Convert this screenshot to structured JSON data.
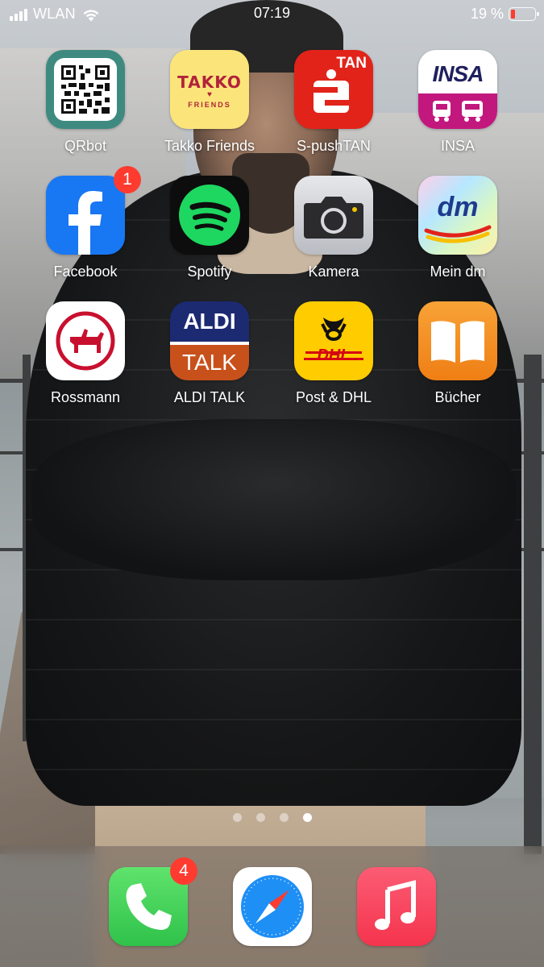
{
  "status_bar": {
    "carrier": "WLAN",
    "time": "07:19",
    "battery_text": "19 %",
    "battery_level": 0.19
  },
  "apps": [
    {
      "label": "QRbot",
      "icon": "qr-code-icon"
    },
    {
      "label": "Takko Friends",
      "icon": "takko-logo-icon",
      "icon_text": "TAKKO",
      "icon_subtext": "FRIENDS"
    },
    {
      "label": "S-pushTAN",
      "icon": "sparkasse-tan-icon",
      "icon_text": "TAN"
    },
    {
      "label": "INSA",
      "icon": "insa-bus-icon",
      "icon_text": "INSA"
    },
    {
      "label": "Facebook",
      "icon": "facebook-icon",
      "badge": "1"
    },
    {
      "label": "Spotify",
      "icon": "spotify-icon"
    },
    {
      "label": "Kamera",
      "icon": "camera-icon"
    },
    {
      "label": "Mein dm",
      "icon": "dm-logo-icon",
      "icon_text": "dm"
    },
    {
      "label": "Rossmann",
      "icon": "rossmann-centaur-icon"
    },
    {
      "label": "ALDI TALK",
      "icon": "aldi-talk-icon",
      "icon_text": "ALDI",
      "icon_subtext": "TALK"
    },
    {
      "label": "Post & DHL",
      "icon": "post-horn-dhl-icon",
      "icon_text": "DHL"
    },
    {
      "label": "Bücher",
      "icon": "book-icon"
    }
  ],
  "page_dots": {
    "count": 4,
    "active_index": 3
  },
  "dock": [
    {
      "name": "phone",
      "icon": "phone-icon",
      "badge": "4"
    },
    {
      "name": "safari",
      "icon": "compass-icon"
    },
    {
      "name": "music",
      "icon": "music-note-icon"
    }
  ],
  "colors": {
    "badge": "#ff3b30",
    "facebook": "#1877f2",
    "spotify": "#1ed760",
    "sparkasse": "#e2231a",
    "insa": "#c2187e",
    "dhl_yellow": "#ffcc00",
    "aldi_blue": "#1c2a72",
    "aldi_orange": "#c8511b",
    "books_orange": "#f28a1c",
    "phone_green": "#3ed357",
    "music_red": "#f94258"
  }
}
